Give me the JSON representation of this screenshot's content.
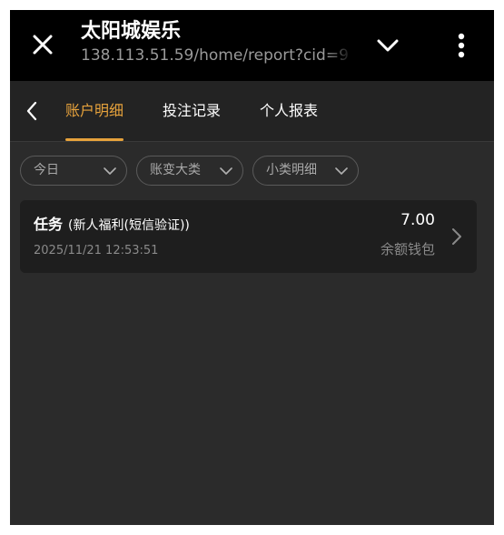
{
  "browser": {
    "title": "太阳城娱乐",
    "url": "138.113.51.59/home/report?cid=9",
    "icons": {
      "close": "close-icon",
      "chevron": "chevron-down-icon",
      "more": "more-vertical-icon"
    }
  },
  "header": {
    "back_icon": "chevron-left-icon",
    "tabs": [
      {
        "label": "账户明细",
        "active": true
      },
      {
        "label": "投注记录",
        "active": false
      },
      {
        "label": "个人报表",
        "active": false
      }
    ]
  },
  "filters": [
    {
      "label": "今日"
    },
    {
      "label": "账变大类"
    },
    {
      "label": "小类明细"
    }
  ],
  "records": [
    {
      "title": "任务",
      "subtitle": "(新人福利(短信验证))",
      "time": "2025/11/21 12:53:51",
      "amount": "7.00",
      "wallet": "余额钱包"
    }
  ],
  "colors": {
    "accent": "#e6a23c",
    "background": "#2b2b2b",
    "card": "#1e1e1e",
    "browser_bar": "#000000"
  }
}
